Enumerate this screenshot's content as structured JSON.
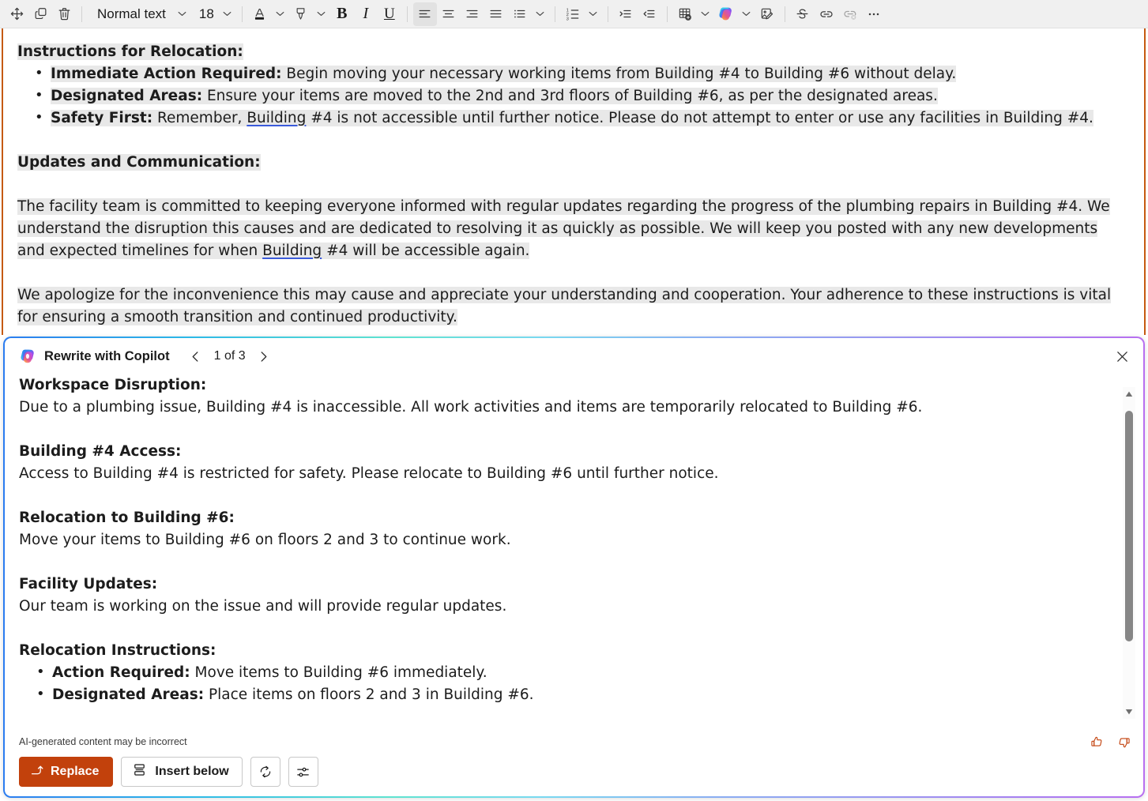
{
  "toolbar": {
    "style_name": "Normal text",
    "font_size": "18",
    "items": [
      {
        "name": "move-handle-icon",
        "label": "Move"
      },
      {
        "name": "duplicate-icon",
        "label": "Duplicate"
      },
      {
        "name": "delete-icon",
        "label": "Delete"
      },
      {
        "name": "font-color-icon",
        "label": "Font color"
      },
      {
        "name": "highlight-icon",
        "label": "Text highlight color"
      },
      {
        "name": "bold-icon",
        "label": "Bold"
      },
      {
        "name": "italic-icon",
        "label": "Italic"
      },
      {
        "name": "underline-icon",
        "label": "Underline"
      },
      {
        "name": "align-left-icon",
        "label": "Align left"
      },
      {
        "name": "align-center-icon",
        "label": "Align center"
      },
      {
        "name": "align-right-icon",
        "label": "Align right"
      },
      {
        "name": "align-justify-icon",
        "label": "Justify"
      },
      {
        "name": "bulleted-list-icon",
        "label": "Bulleted list"
      },
      {
        "name": "numbered-list-icon",
        "label": "Numbered list"
      },
      {
        "name": "increase-indent-icon",
        "label": "Increase indent"
      },
      {
        "name": "decrease-indent-icon",
        "label": "Decrease indent"
      },
      {
        "name": "insert-table-icon",
        "label": "Insert table"
      },
      {
        "name": "copilot-icon",
        "label": "Copilot"
      },
      {
        "name": "edit-image-icon",
        "label": "Edit image"
      },
      {
        "name": "strikethrough-icon",
        "label": "Strikethrough"
      },
      {
        "name": "link-icon",
        "label": "Insert link"
      },
      {
        "name": "unlink-icon",
        "label": "Remove link"
      },
      {
        "name": "more-options-icon",
        "label": "More options"
      }
    ]
  },
  "document": {
    "heading1": "Instructions for Relocation:",
    "bullets": [
      {
        "bold": "Immediate Action Required:",
        "rest": " Begin moving your necessary working items from Building #4 to Building #6 without delay."
      },
      {
        "bold": "Designated Areas:",
        "rest": " Ensure your items are moved to the 2nd and 3rd floors of Building #6, as per the designated areas."
      },
      {
        "bold": "Safety First:",
        "rest_a": " Remember, ",
        "link": "Building",
        "rest_b": " #4 is not accessible until further notice. Please do not attempt to enter or use any facilities in Building #4."
      }
    ],
    "heading2": "Updates and Communication:",
    "para1_a": "The facility team is committed to keeping everyone informed with regular updates regarding the progress of the plumbing repairs in Building #4. We understand the disruption this causes and are dedicated to resolving it as quickly as possible. We will keep you posted with any new developments and expected timelines for when ",
    "para1_link": "Building",
    "para1_b": " #4 will be accessible again.",
    "para2": "We apologize for the inconvenience this may cause and appreciate your understanding and cooperation. Your adherence to these instructions is vital for ensuring a smooth transition and continued productivity."
  },
  "copilot": {
    "title": "Rewrite with Copilot",
    "counter": "1 of 3",
    "prev_label": "Previous suggestion",
    "next_label": "Next suggestion",
    "close_label": "Close",
    "disclaimer": "AI-generated content may be incorrect",
    "sections": [
      {
        "heading": "Workspace Disruption:",
        "body": "Due to a plumbing issue, Building #4 is inaccessible. All work activities and items are temporarily relocated to Building #6."
      },
      {
        "heading": "Building #4 Access:",
        "body": "Access to Building #4 is restricted for safety. Please relocate to Building #6 until further notice."
      },
      {
        "heading": "Relocation to Building #6:",
        "body": "Move your items to Building #6 on floors 2 and 3 to continue work."
      },
      {
        "heading": "Facility Updates:",
        "body": "Our team is working on the issue and will provide regular updates."
      }
    ],
    "list_heading": "Relocation Instructions:",
    "list_items": [
      {
        "bold": "Action Required:",
        "rest": " Move items to Building #6 immediately."
      },
      {
        "bold": "Designated Areas:",
        "rest": " Place items on floors 2 and 3 in Building #6."
      }
    ],
    "actions": {
      "replace": "Replace",
      "insert_below": "Insert below",
      "regenerate_label": "Regenerate",
      "settings_label": "Adjust settings"
    },
    "feedback": {
      "like_label": "Like",
      "dislike_label": "Dislike"
    }
  },
  "colors": {
    "accent_orange": "#c2410c",
    "doc_rail": "#c55a11",
    "selection_highlight": "#e8e8e8",
    "link_underline": "#3b5bdb"
  }
}
